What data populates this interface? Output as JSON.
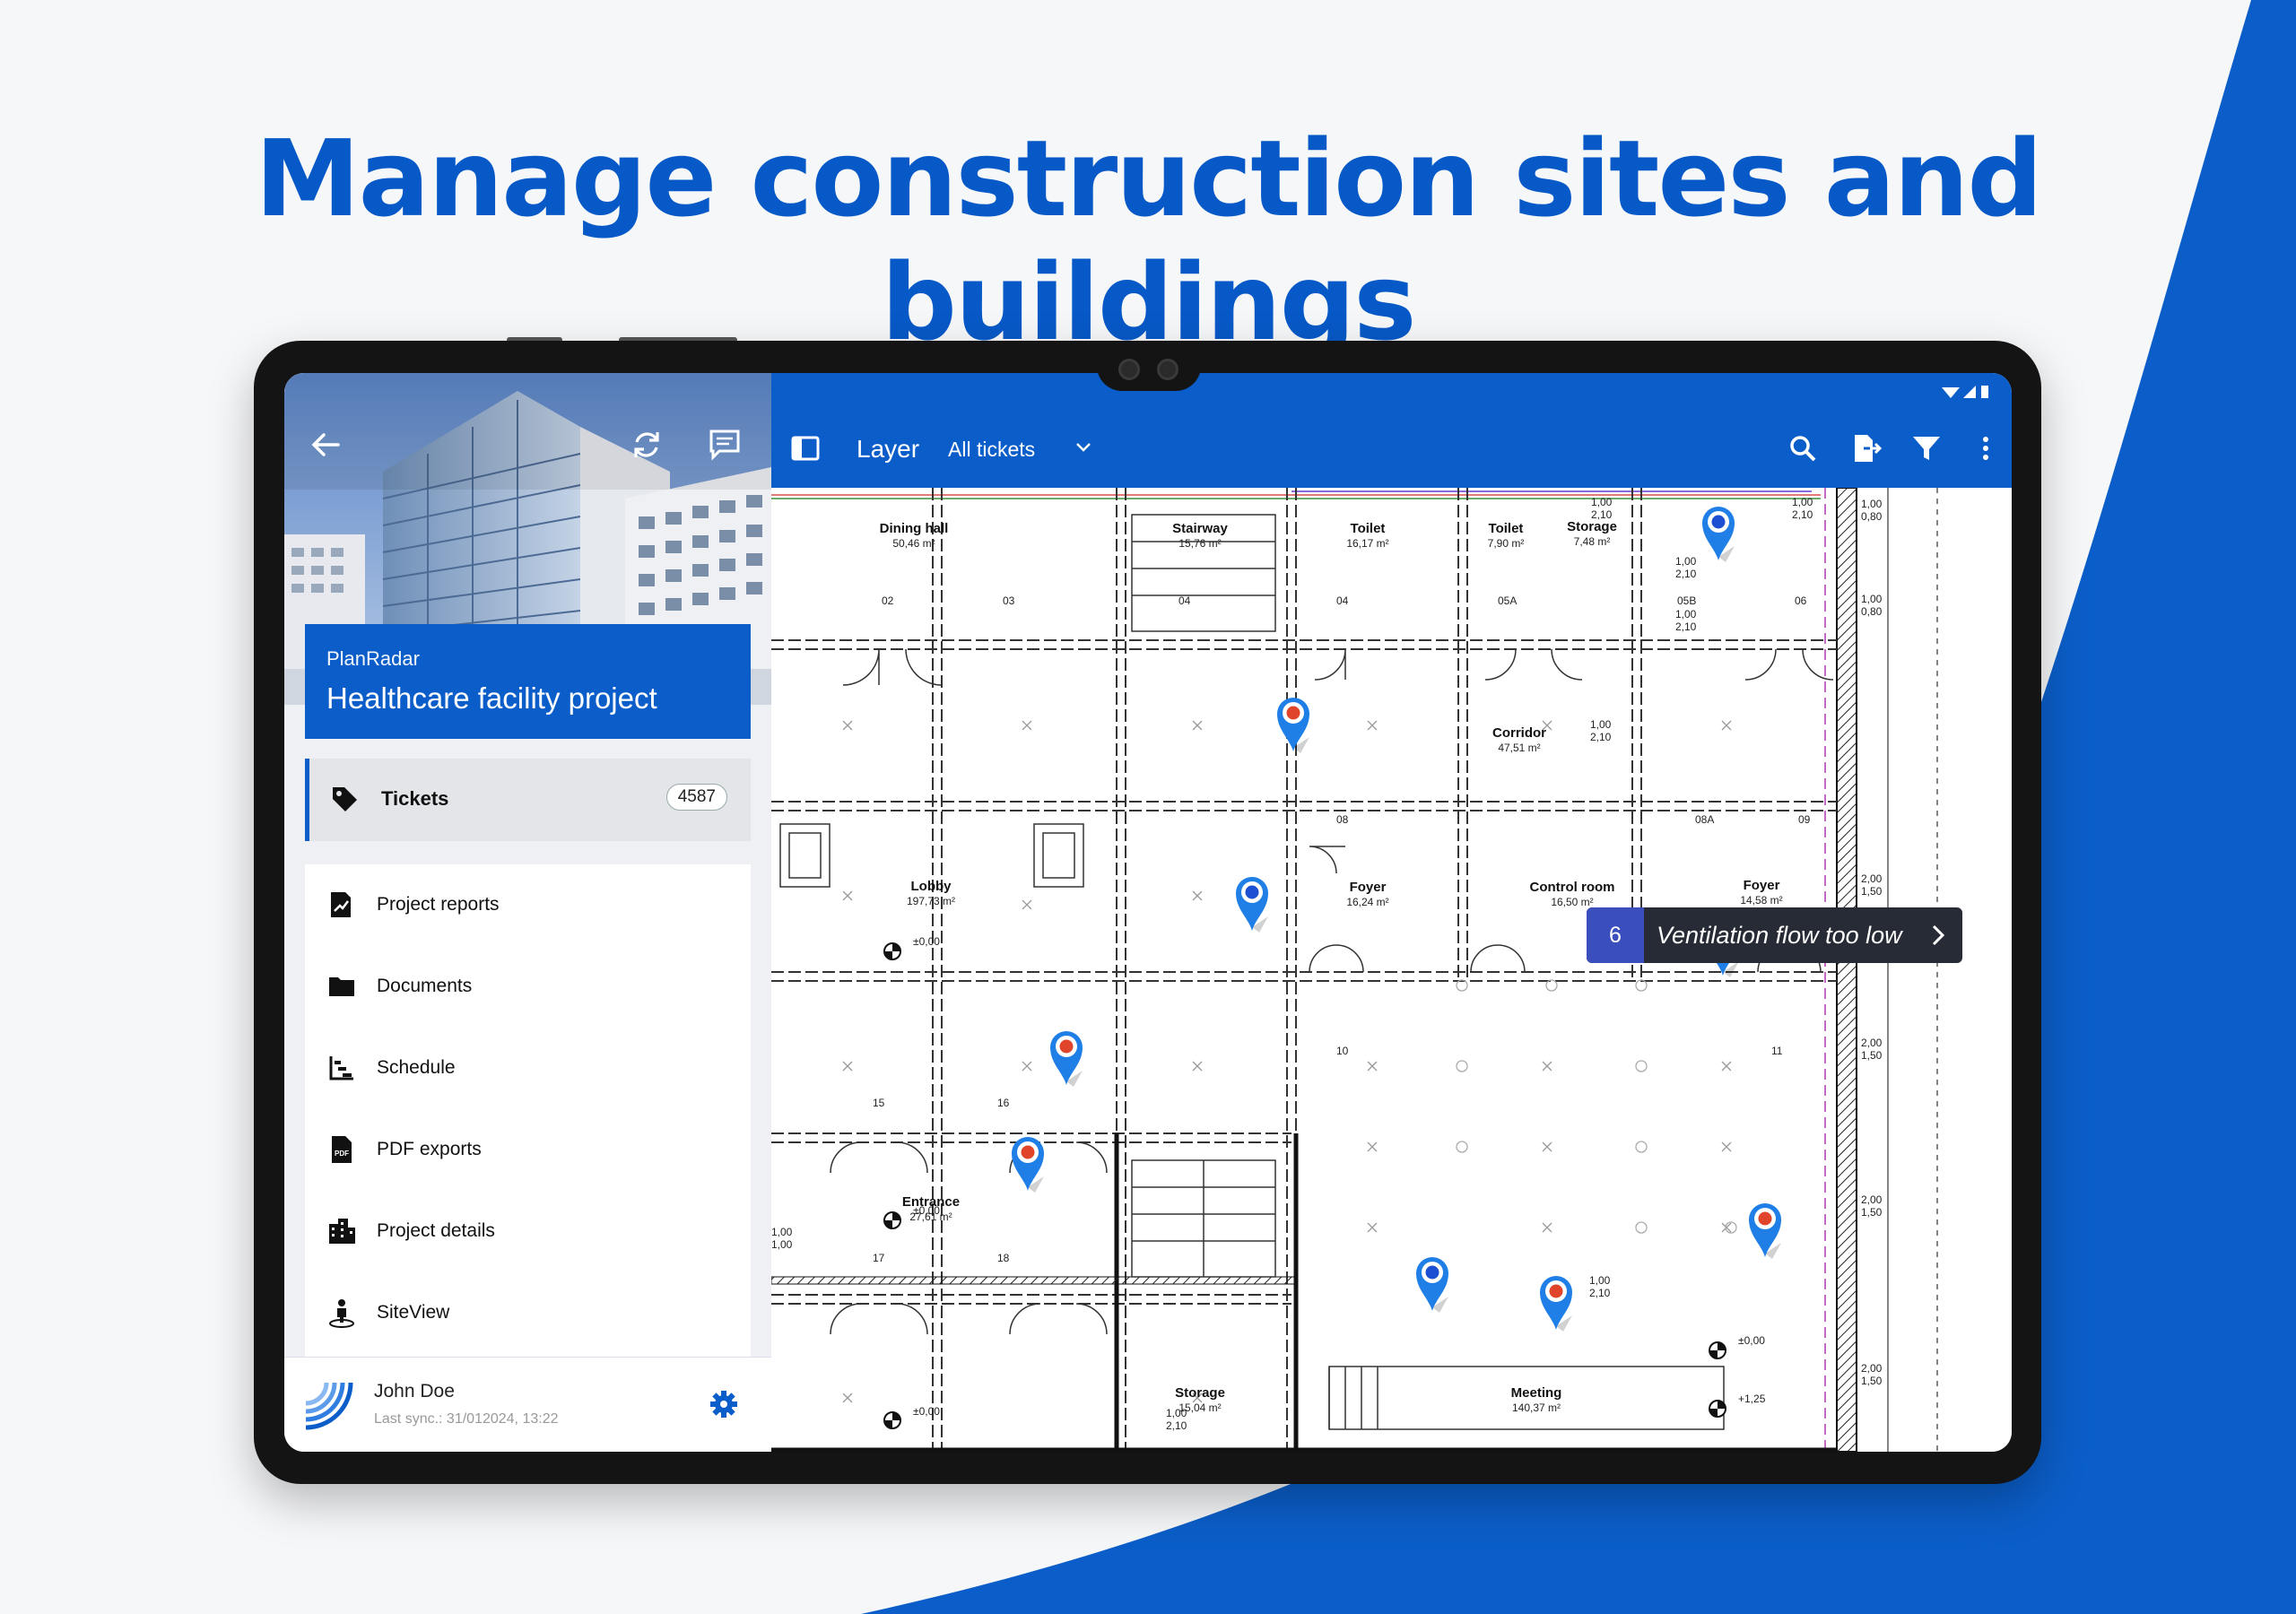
{
  "headline": "Manage construction sites and buildings",
  "colors": {
    "brand": "#0b5ec9",
    "headline": "#0759c7",
    "fab": "#57a632",
    "pin_red": "#e0452c",
    "pin_blue": "#1c4fd1"
  },
  "sidebar": {
    "org": "PlanRadar",
    "project_name": "Healthcare facility project",
    "hero_icons": [
      "back-arrow-icon",
      "sync-icon",
      "chat-icon"
    ],
    "tickets": {
      "label": "Tickets",
      "count": "4587"
    },
    "items": [
      {
        "label": "Project reports",
        "icon": "report-icon"
      },
      {
        "label": "Documents",
        "icon": "folder-icon"
      },
      {
        "label": "Schedule",
        "icon": "schedule-icon"
      },
      {
        "label": "PDF exports",
        "icon": "pdf-icon"
      },
      {
        "label": "Project details",
        "icon": "building-icon"
      },
      {
        "label": "SiteView",
        "icon": "siteview-icon"
      }
    ],
    "user": {
      "name": "John Doe",
      "last_sync": "Last sync.: 31/012024, 13:22"
    }
  },
  "toolbar": {
    "title": "Layer",
    "filter": "All tickets",
    "actions": [
      "search-icon",
      "export-icon",
      "filter-icon",
      "more-icon"
    ]
  },
  "plan": {
    "rooms": [
      {
        "name": "Dining hall",
        "area": "50,46 m²"
      },
      {
        "name": "Stairway",
        "area": "15,76 m²"
      },
      {
        "name": "Toilet",
        "area": "16,17 m²"
      },
      {
        "name": "Toilet",
        "area": "7,90 m²"
      },
      {
        "name": "Storage",
        "area": "7,48 m²"
      },
      {
        "name": "Corridor",
        "area": "47,51 m²"
      },
      {
        "name": "Lobby",
        "area": "197,73 m²"
      },
      {
        "name": "Foyer",
        "area": "16,24 m²"
      },
      {
        "name": "Control room",
        "area": "16,50 m²"
      },
      {
        "name": "Foyer",
        "area": "14,58 m²"
      },
      {
        "name": "Entrance",
        "area": "27,61 m²"
      },
      {
        "name": "Storage",
        "area": "15,04 m²"
      },
      {
        "name": "Meeting",
        "area": "140,37 m²"
      }
    ],
    "levels": [
      "±0,00",
      "±0,00",
      "±0,00",
      "±0,00",
      "+1,25"
    ],
    "tooltip": {
      "number": "6",
      "text": "Ventilation flow too low"
    },
    "pins": [
      "red",
      "blue",
      "blue",
      "red",
      "blue",
      "red",
      "blue",
      "red",
      "red"
    ]
  },
  "fab": {
    "label": "+"
  }
}
